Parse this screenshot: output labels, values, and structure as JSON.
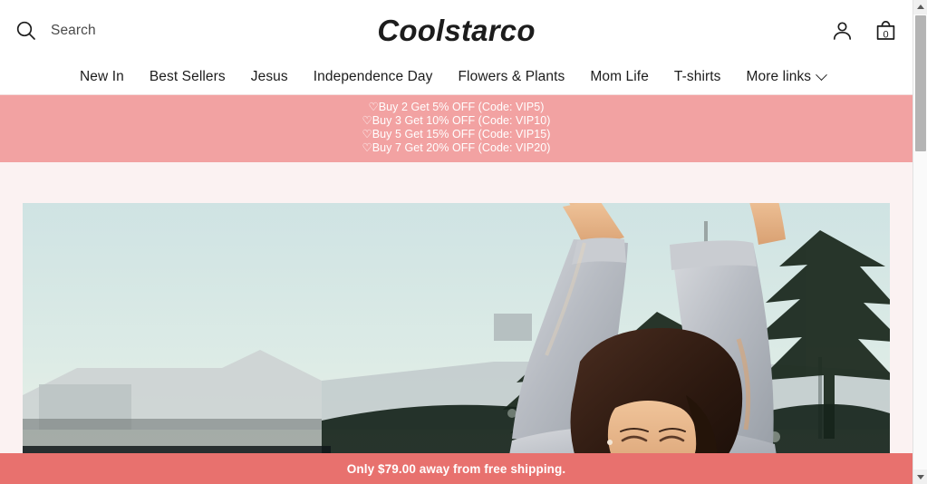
{
  "header": {
    "search": {
      "icon": "search-icon",
      "label": "Search"
    },
    "logo": "Coolstarco",
    "account_icon": "person-icon",
    "cart_icon": "shopping-bag-icon",
    "cart_count": "0"
  },
  "nav": {
    "items": [
      {
        "label": "New In",
        "has_dropdown": false
      },
      {
        "label": "Best Sellers",
        "has_dropdown": false
      },
      {
        "label": "Jesus",
        "has_dropdown": false
      },
      {
        "label": "Independence Day",
        "has_dropdown": false
      },
      {
        "label": "Flowers & Plants",
        "has_dropdown": false
      },
      {
        "label": "Mom Life",
        "has_dropdown": false
      },
      {
        "label": "T-shirts",
        "has_dropdown": false
      },
      {
        "label": "More links",
        "has_dropdown": true
      }
    ]
  },
  "promo": {
    "background": "#f2a2a2",
    "text_color": "#ffffff",
    "lines": [
      "♡Buy 2 Get 5% OFF (Code: VIP5)",
      "♡Buy 3 Get 10% OFF (Code: VIP10)",
      "♡Buy 5 Get 15% OFF (Code: VIP15)",
      "♡Buy 7 Get 20% OFF (Code: VIP20)"
    ]
  },
  "hero": {
    "alt": "Woman stretching arms overhead outdoors at sunset wearing a grey sweatshirt, pine trees and low buildings in the background"
  },
  "shipping_bar": {
    "background": "#e8716e",
    "text": "Only $79.00 away from free shipping."
  },
  "scrollbar": {
    "up_arrow": "scroll-up-arrow",
    "down_arrow": "scroll-down-arrow"
  },
  "colors": {
    "page_background": "#fbf2f2",
    "header_background": "#ffffff",
    "promo_pink": "#f2a2a2",
    "ship_coral": "#e8716e",
    "text_dark": "#1c1c1c"
  }
}
